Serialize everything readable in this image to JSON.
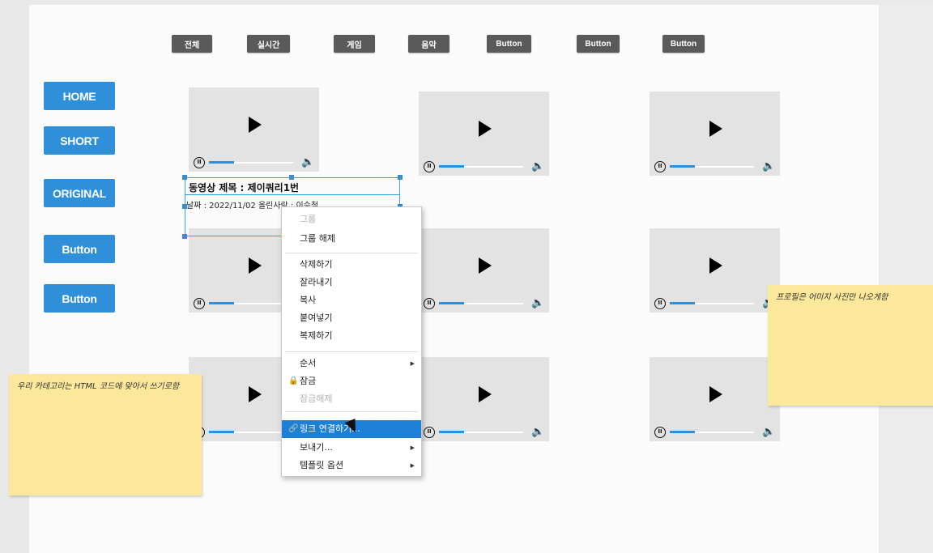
{
  "categories": [
    "전체",
    "실시간",
    "게임",
    "음악",
    "Button",
    "Button",
    "Button"
  ],
  "nav": {
    "items": [
      "HOME",
      "SHORT",
      "ORIGINAL",
      "Button",
      "Button"
    ]
  },
  "selected_video": {
    "title": "동영상 제목 : 제이쿼리1번",
    "meta": "날짜 : 2022/11/02  올린사람 : 이승철"
  },
  "player": {
    "pause_glyph": "II",
    "volume_glyph": "🔈",
    "progress": 0.3
  },
  "notes": [
    {
      "text": "우리 카테고리는 HTML 코드에 맞아서 쓰기로함"
    },
    {
      "text": "프로필은 어미지 사진만 나오게함"
    }
  ],
  "context_menu": {
    "items": [
      {
        "label": "그룹",
        "disabled": true
      },
      {
        "label": "그룹 해제"
      },
      {
        "label": "삭제하기"
      },
      {
        "label": "잘라내기"
      },
      {
        "label": "복사"
      },
      {
        "label": "붙여넣기"
      },
      {
        "label": "복제하기"
      },
      {
        "label": "순서",
        "submenu": true
      },
      {
        "label": "잠금",
        "icon": "lock"
      },
      {
        "label": "잠금해제",
        "disabled": true
      },
      {
        "label": "링크 연결하기...",
        "icon": "link",
        "highlighted": true
      },
      {
        "label": "보내기...",
        "submenu": true
      },
      {
        "label": "템플릿 옵션",
        "submenu": true
      }
    ]
  },
  "colors": {
    "accent": "#2f8fd9",
    "pill": "#5a5a5a",
    "sticky": "#fce89a"
  }
}
